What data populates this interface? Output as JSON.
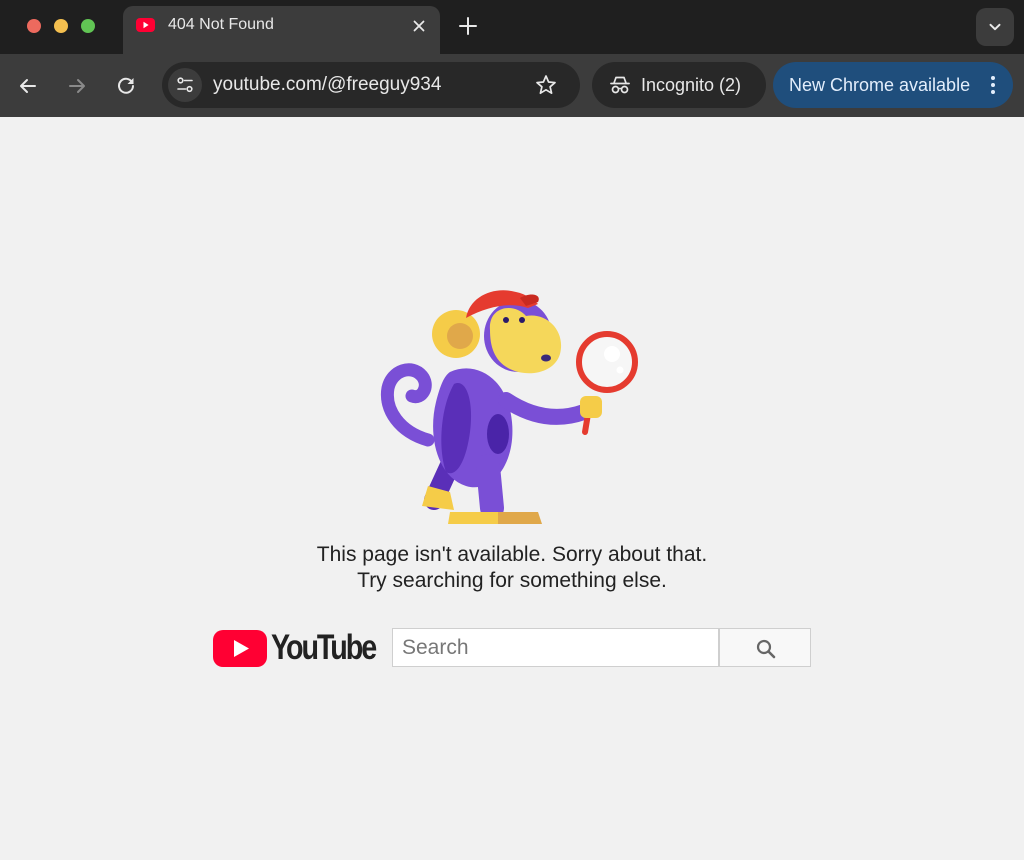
{
  "tab": {
    "title": "404 Not Found"
  },
  "omnibox": {
    "url": "youtube.com/@freeguy934"
  },
  "incognito": {
    "label": "Incognito (2)"
  },
  "update": {
    "label": "New Chrome available"
  },
  "page": {
    "message_line1": "This page isn't available. Sorry about that.",
    "message_line2": "Try searching for something else.",
    "logo_text": "YouTube",
    "search_placeholder": "Search"
  },
  "icons": {
    "favicon": "youtube-play-icon",
    "close": "close-icon",
    "new_tab": "plus-icon",
    "tab_search": "chevron-down-icon",
    "back": "arrow-left-icon",
    "forward": "arrow-right-icon",
    "reload": "reload-icon",
    "site_info": "tune-icon",
    "bookmark": "star-icon",
    "incognito": "incognito-icon",
    "menu": "more-vert-icon",
    "search": "magnifier-icon"
  },
  "colors": {
    "youtube_red": "#ff0033",
    "chrome_dark": "#1f1f1f",
    "toolbar": "#3c3c3c",
    "update_blue": "#1f4e7c",
    "page_bg": "#f1f1f1"
  }
}
